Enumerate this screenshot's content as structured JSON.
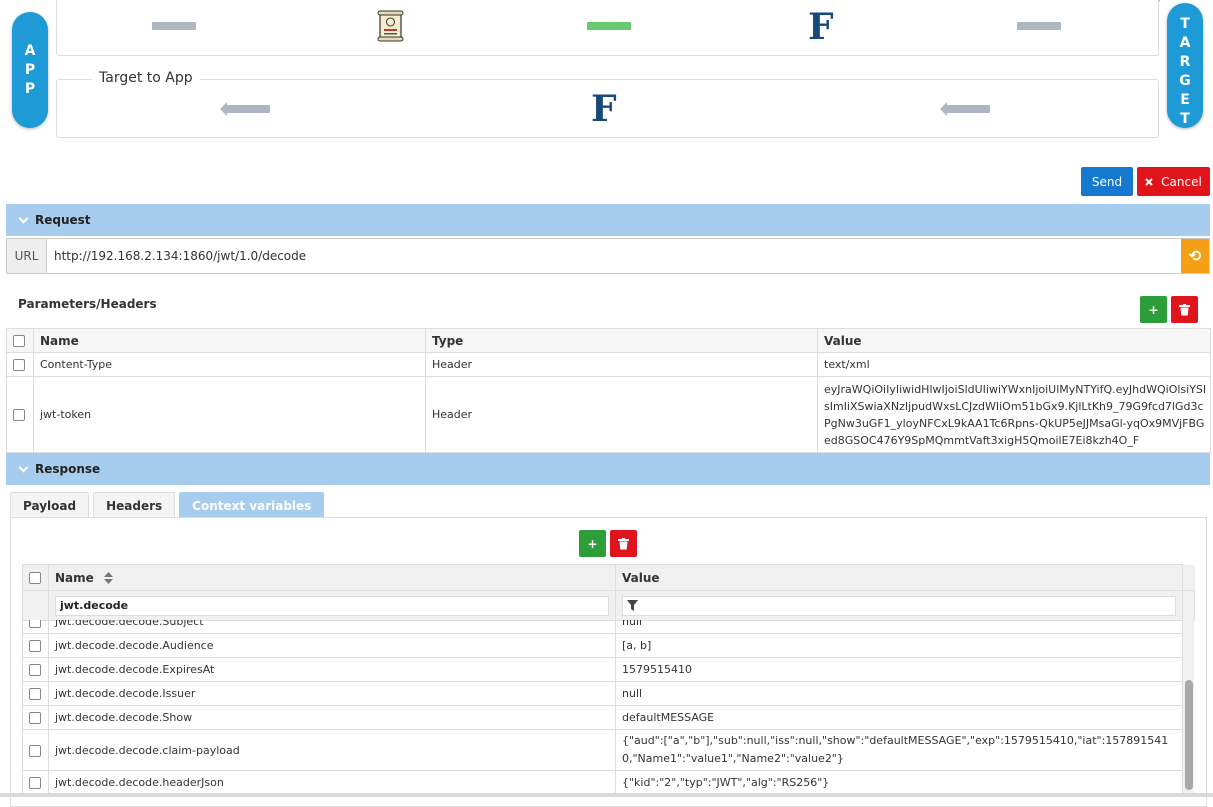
{
  "flow": {
    "app_letters": [
      "A",
      "P",
      "P"
    ],
    "target_letters": [
      "T",
      "A",
      "R",
      "G",
      "E",
      "T"
    ],
    "response_legend": "Target to App",
    "logo_letter": "F"
  },
  "actions": {
    "send": "Send",
    "cancel": "Cancel"
  },
  "request": {
    "section_title": "Request",
    "url_label": "URL",
    "url_value": "http://192.168.2.134:1860/jwt/1.0/decode",
    "params_title": "Parameters/Headers",
    "columns": [
      "Name",
      "Type",
      "Value"
    ],
    "rows": [
      {
        "name": "Content-Type",
        "type": "Header",
        "value": "text/xml"
      },
      {
        "name": "jwt-token",
        "type": "Header",
        "value": "eyJraWQiOiIyIiwidHlwIjoiSldUIiwiYWxnIjoiUlMyNTYifQ.eyJhdWQiOlsiYSIsImIiXSwiaXNzIjpudWxsLCJzdWIiOm51bGx9.KjlLtKh9_79G9fcd7lGd3cPgNw3uGF1_yloyNFCxL9kAA1Tc6Rpns-QkUP5eJJMsaGl-yqOx9MVjFBGed8GSOC476Y9SpMQmmtVaft3xigH5QmoilE7Ei8kzh4O_F"
      }
    ]
  },
  "response": {
    "section_title": "Response",
    "tabs": [
      "Payload",
      "Headers",
      "Context variables"
    ],
    "active_tab": "Context variables",
    "columns": [
      "Name",
      "Value"
    ],
    "filter_name": "jwt.decode",
    "filter_value": "",
    "rows": [
      {
        "name": "jwt.decode.decode.Subject",
        "value": "null"
      },
      {
        "name": "jwt.decode.decode.Audience",
        "value": "[a, b]"
      },
      {
        "name": "jwt.decode.decode.ExpiresAt",
        "value": "1579515410"
      },
      {
        "name": "jwt.decode.decode.Issuer",
        "value": "null"
      },
      {
        "name": "jwt.decode.decode.Show",
        "value": "defaultMESSAGE"
      },
      {
        "name": "jwt.decode.decode.claim-payload",
        "value": "{\"aud\":[\"a\",\"b\"],\"sub\":null,\"iss\":null,\"show\":\"defaultMESSAGE\",\"exp\":1579515410,\"iat\":1578915410,\"Name1\":\"value1\",\"Name2\":\"value2\"}"
      },
      {
        "name": "jwt.decode.decode.headerJson",
        "value": "{\"kid\":\"2\",\"typ\":\"JWT\",\"alg\":\"RS256\"}"
      }
    ]
  },
  "colors": {
    "primary": "#1579d0",
    "danger": "#e2141b",
    "success": "#2e9e3a",
    "warning": "#f4a017",
    "section_bar": "#a6cdee",
    "pill": "#1e9ad6",
    "logo": "#164a7a"
  }
}
